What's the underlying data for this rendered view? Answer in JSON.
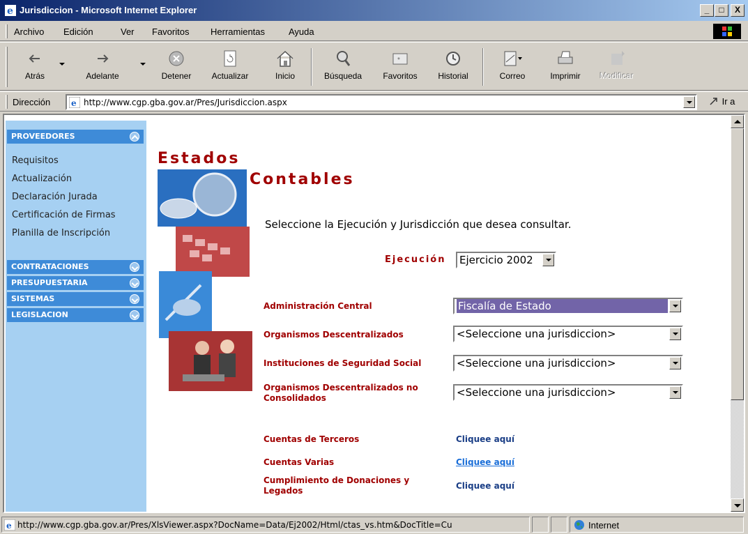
{
  "window": {
    "title": "Jurisdiccion - Microsoft Internet Explorer",
    "min": "_",
    "max": "□",
    "close": "X"
  },
  "menu": [
    "Archivo",
    "Edición",
    "Ver",
    "Favoritos",
    "Herramientas",
    "Ayuda"
  ],
  "toolbar": {
    "back": "Atrás",
    "forward": "Adelante",
    "stop": "Detener",
    "refresh": "Actualizar",
    "home": "Inicio",
    "search": "Búsqueda",
    "favorites": "Favoritos",
    "history": "Historial",
    "mail": "Correo",
    "print": "Imprimir",
    "edit": "Modificar"
  },
  "address": {
    "label": "Dirección",
    "url": "http://www.cgp.gba.gov.ar/Pres/Jurisdiccion.aspx",
    "go": "Ir a"
  },
  "sidebar": {
    "proveedores": "PROVEEDORES",
    "links": [
      "Requisitos",
      "Actualización",
      "Declaración Jurada",
      "Certificación de Firmas",
      "Planilla de Inscripción"
    ],
    "contrataciones": "CONTRATACIONES",
    "presupuestaria": "PRESUPUESTARIA",
    "sistemas": "SISTEMAS",
    "legislacion": "LEGISLACION"
  },
  "main": {
    "heading1": "Estados",
    "heading2": "Contables",
    "intro": "Seleccione la Ejecución y Jurisdicción que desea consultar.",
    "ejecucion_label": "Ejecución",
    "ejecucion_value": "Ejercicio 2002",
    "rows": [
      {
        "label": "Administración Central",
        "value": "Fiscalía de Estado"
      },
      {
        "label": "Organismos Descentralizados",
        "value": "<Seleccione una jurisdiccion>"
      },
      {
        "label": "Instituciones de Seguridad Social",
        "value": "<Seleccione una jurisdiccion>"
      },
      {
        "label": "Organismos Descentralizados no Consolidados",
        "value": "<Seleccione una jurisdiccion>"
      }
    ],
    "links": [
      {
        "label": "Cuentas de Terceros",
        "link": "Cliquee aquí"
      },
      {
        "label": "Cuentas Varias",
        "link": "Cliquee aquí"
      },
      {
        "label": "Cumplimiento de Donaciones y Legados",
        "link": "Cliquee aquí"
      }
    ]
  },
  "status": {
    "text": "http://www.cgp.gba.gov.ar/Pres/XlsViewer.aspx?DocName=Data/Ej2002/Html/ctas_vs.htm&DocTitle=Cu",
    "zone": "Internet"
  },
  "colors": {
    "title_start": "#0a246a",
    "heading": "#a00000",
    "sidebar_bg": "#a6d0f2",
    "section_head": "#3e8bd8",
    "selected": "#7264a8"
  }
}
